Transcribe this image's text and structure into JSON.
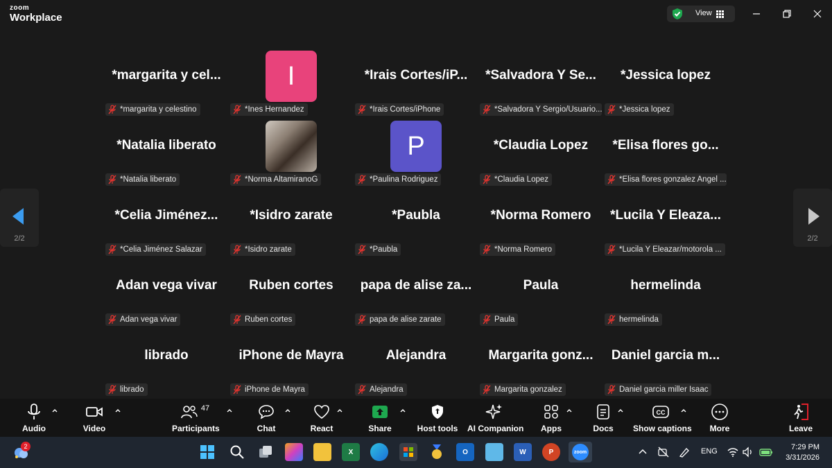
{
  "app": {
    "brand_top": "zoom",
    "brand_bottom": "Workplace",
    "view_label": "View"
  },
  "page_indicator": {
    "left": "2/2",
    "right": "2/2"
  },
  "tiles": [
    {
      "name": "*margarita  y  cel...",
      "label": "*margarita y celestino"
    },
    {
      "name": "",
      "label": "*Ines Hernandez",
      "avatar_letter": "I",
      "avatar_color": "#e8437b"
    },
    {
      "name": "*Irais  Cortes/iP...",
      "label": "*Irais Cortes/iPhone"
    },
    {
      "name": "*Salvadora  Y  Se...",
      "label": "*Salvadora Y Sergio/Usuario..."
    },
    {
      "name": "*Jessica lopez",
      "label": "*Jessica lopez"
    },
    {
      "name": "*Natalia liberato",
      "label": "*Natalia liberato"
    },
    {
      "name": "",
      "label": "*Norma AltamiranoG",
      "photo": true
    },
    {
      "name": "",
      "label": "*Paulina Rodriguez",
      "avatar_letter": "P",
      "avatar_color": "#5b54c9"
    },
    {
      "name": "*Claudia Lopez",
      "label": "*Claudia Lopez"
    },
    {
      "name": "*Elisa  flores  go...",
      "label": "*Elisa flores gonzalez Angel ..."
    },
    {
      "name": "*Celia  Jiménez...",
      "label": "*Celia Jiménez Salazar"
    },
    {
      "name": "*Isidro zarate",
      "label": "*Isidro zarate"
    },
    {
      "name": "*Paubla",
      "label": "*Paubla"
    },
    {
      "name": "*Norma Romero",
      "label": "*Norma Romero"
    },
    {
      "name": "*Lucila  Y  Eleaza...",
      "label": "*Lucila Y Eleazar/motorola ..."
    },
    {
      "name": "Adan vega vivar",
      "label": "Adan vega vivar"
    },
    {
      "name": "Ruben cortes",
      "label": "Ruben cortes"
    },
    {
      "name": "papa de alise za...",
      "label": "papa de alise zarate"
    },
    {
      "name": "Paula",
      "label": "Paula"
    },
    {
      "name": "hermelinda",
      "label": "hermelinda"
    },
    {
      "name": "librado",
      "label": "librado"
    },
    {
      "name": "iPhone de Mayra",
      "label": "iPhone de Mayra"
    },
    {
      "name": "Alejandra",
      "label": "Alejandra"
    },
    {
      "name": "Margarita  gonz...",
      "label": "Margarita gonzalez"
    },
    {
      "name": "Daniel garcia  m...",
      "label": "Daniel garcia miller Isaac"
    }
  ],
  "toolbar": {
    "audio": "Audio",
    "video": "Video",
    "participants": "Participants",
    "participants_count": "47",
    "chat": "Chat",
    "react": "React",
    "share": "Share",
    "host_tools": "Host tools",
    "ai_companion": "AI Companion",
    "apps": "Apps",
    "docs": "Docs",
    "show_captions": "Show captions",
    "more": "More",
    "leave": "Leave"
  },
  "taskbar": {
    "weather_badge": "2",
    "language": "ENG",
    "time": "7:29 PM",
    "date": "3/31/2026"
  },
  "colors": {
    "share_green": "#1ea84f",
    "leave_red": "#e0202b",
    "accent_blue": "#3b82f6"
  }
}
